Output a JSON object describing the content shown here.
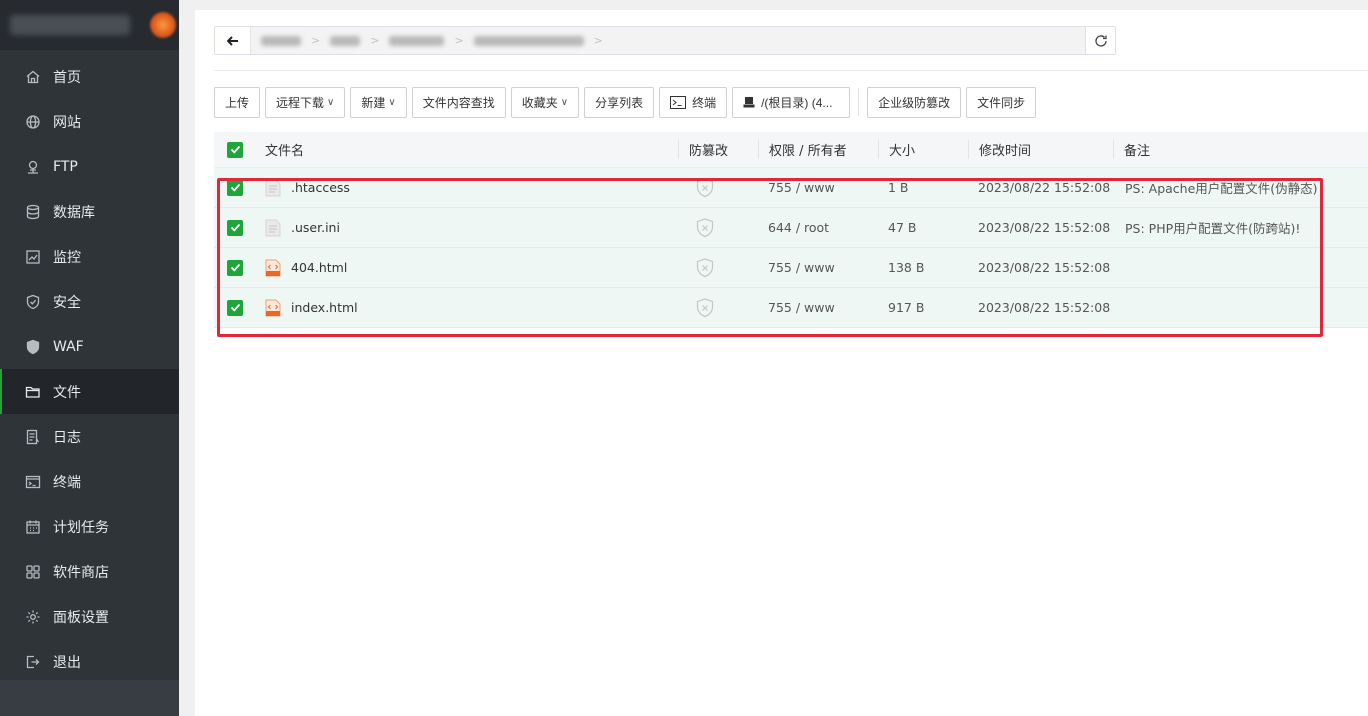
{
  "sidebar": {
    "items": [
      {
        "label": "首页",
        "icon": "home-icon"
      },
      {
        "label": "网站",
        "icon": "globe-icon"
      },
      {
        "label": "FTP",
        "icon": "ftp-icon"
      },
      {
        "label": "数据库",
        "icon": "database-icon"
      },
      {
        "label": "监控",
        "icon": "monitor-icon"
      },
      {
        "label": "安全",
        "icon": "shield-icon"
      },
      {
        "label": "WAF",
        "icon": "waf-icon"
      },
      {
        "label": "文件",
        "icon": "folder-icon",
        "active": true
      },
      {
        "label": "日志",
        "icon": "log-icon"
      },
      {
        "label": "终端",
        "icon": "terminal-icon"
      },
      {
        "label": "计划任务",
        "icon": "calendar-icon"
      },
      {
        "label": "软件商店",
        "icon": "grid-icon"
      },
      {
        "label": "面板设置",
        "icon": "gear-icon"
      },
      {
        "label": "退出",
        "icon": "logout-icon"
      }
    ]
  },
  "toolbar": {
    "upload": "上传",
    "remote_download": "远程下载",
    "new": "新建",
    "content_search": "文件内容查找",
    "favorites": "收藏夹",
    "share_list": "分享列表",
    "terminal": "终端",
    "root_dir": "/(根目录) (4...",
    "enterprise_tamper": "企业级防篡改",
    "file_sync": "文件同步"
  },
  "table": {
    "headers": {
      "name": "文件名",
      "tamper": "防篡改",
      "perm": "权限 / 所有者",
      "size": "大小",
      "mtime": "修改时间",
      "note": "备注"
    },
    "rows": [
      {
        "name": ".htaccess",
        "type": "text",
        "perm": "755 / www",
        "size": "1 B",
        "mtime": "2023/08/22 15:52:08",
        "note": "PS: Apache用户配置文件(伪静态)"
      },
      {
        "name": ".user.ini",
        "type": "text",
        "perm": "644 / root",
        "size": "47 B",
        "mtime": "2023/08/22 15:52:08",
        "note": "PS: PHP用户配置文件(防跨站)!"
      },
      {
        "name": "404.html",
        "type": "html",
        "perm": "755 / www",
        "size": "138 B",
        "mtime": "2023/08/22 15:52:08",
        "note": ""
      },
      {
        "name": "index.html",
        "type": "html",
        "perm": "755 / www",
        "size": "917 B",
        "mtime": "2023/08/22 15:52:08",
        "note": ""
      }
    ]
  },
  "colors": {
    "accent": "#20a53a",
    "highlight": "#e0283d",
    "sidebar_bg": "#2f3439",
    "row_selected_bg": "#eef7f3"
  }
}
